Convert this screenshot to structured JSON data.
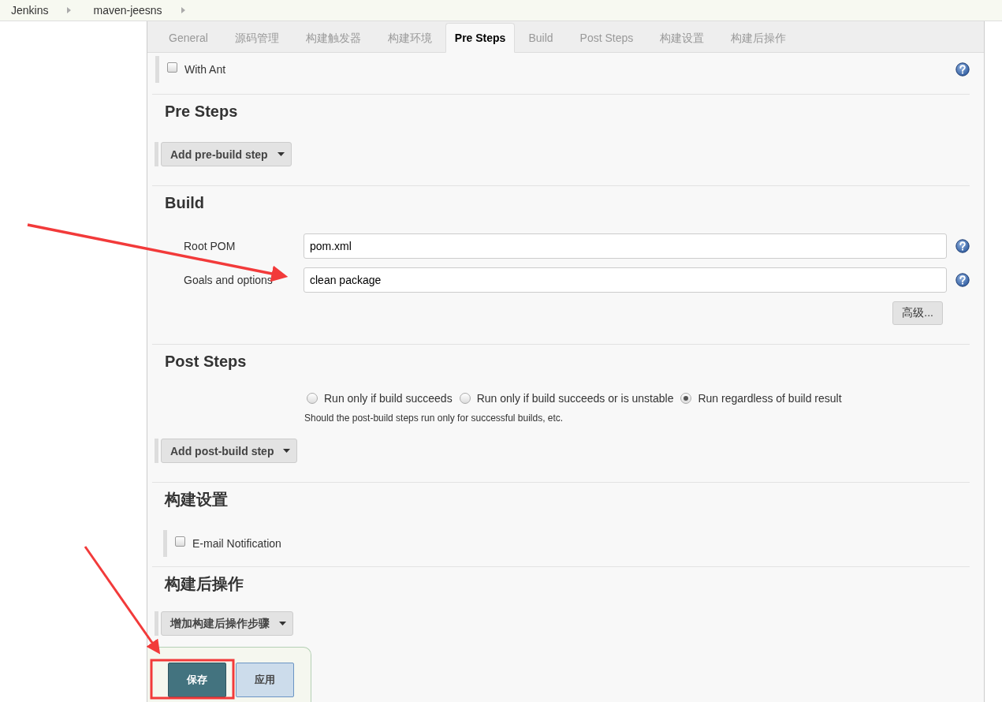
{
  "breadcrumbs": [
    "Jenkins",
    "maven-jeesns"
  ],
  "tabs": [
    {
      "label": "General",
      "selected": false
    },
    {
      "label": "源码管理",
      "selected": false
    },
    {
      "label": "构建触发器",
      "selected": false
    },
    {
      "label": "构建环境",
      "selected": false
    },
    {
      "label": "Pre Steps",
      "selected": true
    },
    {
      "label": "Build",
      "selected": false
    },
    {
      "label": "Post Steps",
      "selected": false
    },
    {
      "label": "构建设置",
      "selected": false
    },
    {
      "label": "构建后操作",
      "selected": false
    }
  ],
  "with_ant": {
    "label": "With Ant",
    "checked": false
  },
  "pre_steps": {
    "heading": "Pre Steps",
    "add_button": "Add pre-build step"
  },
  "build": {
    "heading": "Build",
    "fields": [
      {
        "label": "Root POM",
        "value": "pom.xml"
      },
      {
        "label": "Goals and options",
        "value": "clean package"
      }
    ],
    "advanced_button": "高级..."
  },
  "post_steps": {
    "heading": "Post Steps",
    "options": [
      {
        "label": "Run only if build succeeds",
        "selected": false
      },
      {
        "label": "Run only if build succeeds or is unstable",
        "selected": false
      },
      {
        "label": "Run regardless of build result",
        "selected": true
      }
    ],
    "description": "Should the post-build steps run only for successful builds, etc.",
    "add_button": "Add post-build step"
  },
  "build_settings": {
    "heading": "构建设置",
    "email": {
      "label": "E-mail Notification",
      "checked": false
    }
  },
  "post_build": {
    "heading": "构建后操作",
    "add_button": "增加构建后操作步骤"
  },
  "actions": {
    "save": "保存",
    "apply": "应用"
  }
}
